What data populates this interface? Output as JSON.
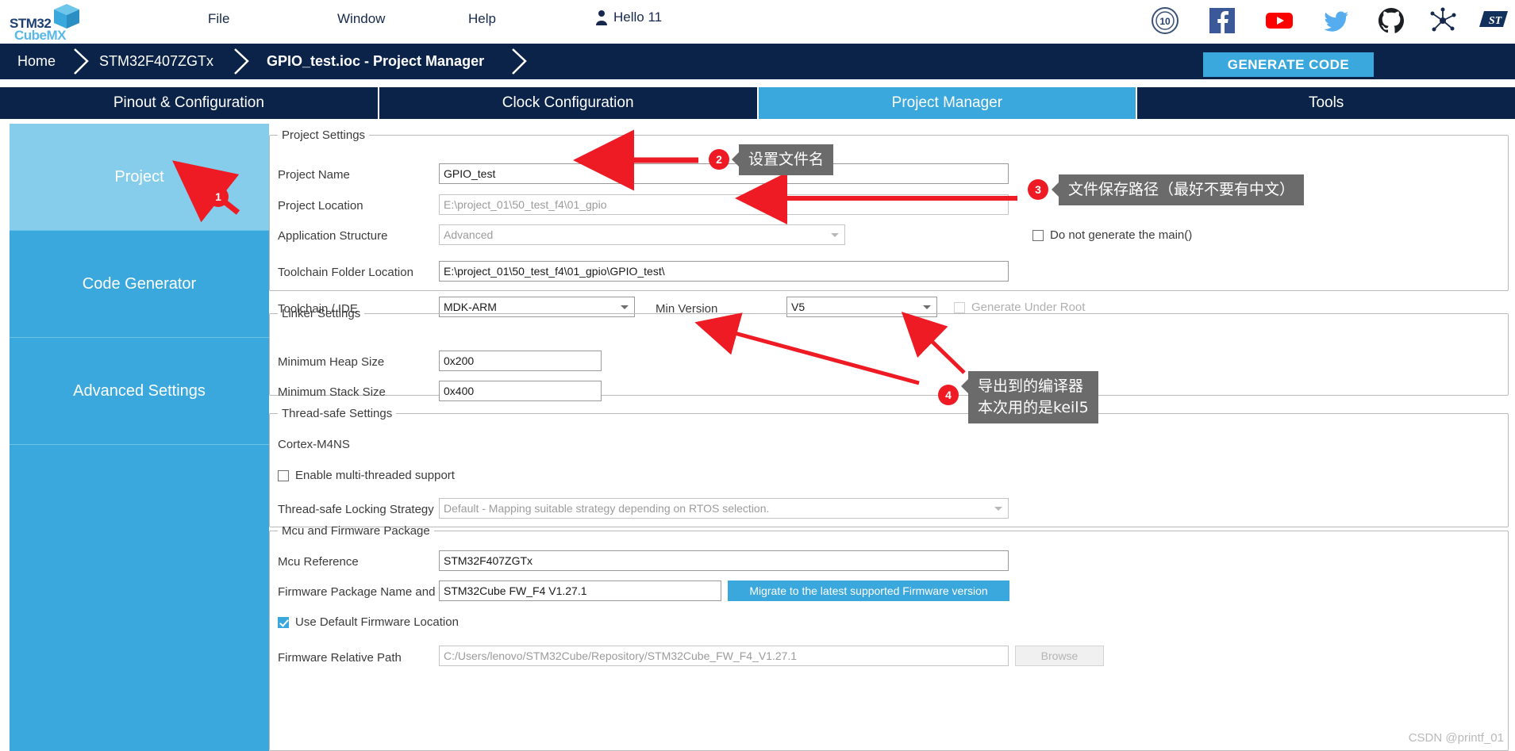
{
  "app": {
    "logo_line1": "STM32",
    "logo_line2": "CubeMX",
    "logo_cube_icon": "cube-icon"
  },
  "menu": {
    "file": "File",
    "window": "Window",
    "help": "Help",
    "user": "Hello 11",
    "user_icon": "user-icon"
  },
  "social": [
    {
      "name": "anniversary-10-years-icon",
      "label": "10"
    },
    {
      "name": "facebook-icon",
      "label": "f"
    },
    {
      "name": "youtube-icon",
      "label": ""
    },
    {
      "name": "twitter-icon",
      "label": ""
    },
    {
      "name": "github-icon",
      "label": ""
    },
    {
      "name": "community-network-icon",
      "label": ""
    },
    {
      "name": "st-logo-icon",
      "label": "ST"
    }
  ],
  "breadcrumb": {
    "home": "Home",
    "mcu": "STM32F407ZGTx",
    "current": "GPIO_test.ioc - Project Manager",
    "generate_code": "GENERATE CODE"
  },
  "tabs": [
    {
      "label": "Pinout & Configuration",
      "active": false
    },
    {
      "label": "Clock Configuration",
      "active": false
    },
    {
      "label": "Project Manager",
      "active": true
    },
    {
      "label": "Tools",
      "active": false
    }
  ],
  "sidebar": {
    "items": [
      {
        "label": "Project",
        "active": true
      },
      {
        "label": "Code Generator",
        "active": false
      },
      {
        "label": "Advanced Settings",
        "active": false
      }
    ]
  },
  "project_settings": {
    "legend": "Project Settings",
    "project_name_label": "Project Name",
    "project_name_value": "GPIO_test",
    "project_location_label": "Project Location",
    "project_location_value": "E:\\project_01\\50_test_f4\\01_gpio",
    "application_structure_label": "Application Structure",
    "application_structure_value": "Advanced",
    "do_not_generate_main_label": "Do not generate the main()",
    "do_not_generate_main_checked": false,
    "toolchain_folder_label": "Toolchain Folder Location",
    "toolchain_folder_value": "E:\\project_01\\50_test_f4\\01_gpio\\GPIO_test\\",
    "toolchain_ide_label": "Toolchain / IDE",
    "toolchain_ide_value": "MDK-ARM",
    "min_version_label": "Min Version",
    "min_version_value": "V5",
    "generate_under_root_label": "Generate Under Root",
    "generate_under_root_checked": false
  },
  "linker_settings": {
    "legend": "Linker Settings",
    "min_heap_label": "Minimum Heap Size",
    "min_heap_value": "0x200",
    "min_stack_label": "Minimum Stack Size",
    "min_stack_value": "0x400"
  },
  "thread_safe_settings": {
    "legend": "Thread-safe Settings",
    "cortex_label": "Cortex-M4NS",
    "enable_multithread_label": "Enable multi-threaded support",
    "enable_multithread_checked": false,
    "locking_strategy_label": "Thread-safe Locking Strategy",
    "locking_strategy_value": "Default  -  Mapping suitable strategy depending on RTOS selection."
  },
  "mcu_firmware": {
    "legend": "Mcu and Firmware Package",
    "mcu_reference_label": "Mcu Reference",
    "mcu_reference_value": "STM32F407ZGTx",
    "firmware_package_label": "Firmware Package Name and Version",
    "firmware_package_value": "STM32Cube FW_F4 V1.27.1",
    "migrate_button_label": "Migrate to the latest supported Firmware version",
    "use_default_location_label": "Use Default Firmware Location",
    "use_default_location_checked": true,
    "firmware_relative_path_label": "Firmware Relative Path",
    "firmware_relative_path_value": "C:/Users/lenovo/STM32Cube/Repository/STM32Cube_FW_F4_V1.27.1",
    "browse_button_label": "Browse"
  },
  "annotations": [
    {
      "number": "1",
      "tooltip": ""
    },
    {
      "number": "2",
      "tooltip": "设置文件名"
    },
    {
      "number": "3",
      "tooltip": "文件保存路径（最好不要有中文）"
    },
    {
      "number": "4",
      "tooltip": "导出到的编译器\n本次用的是keil5"
    }
  ],
  "watermark": "CSDN @printf_01",
  "colors": {
    "navy": "#0b2349",
    "accent_blue": "#3aa8dc",
    "sidebar_active": "#85cdeb",
    "annotation_red": "#ee1b24",
    "tooltip_gray": "#6b6b6b"
  }
}
